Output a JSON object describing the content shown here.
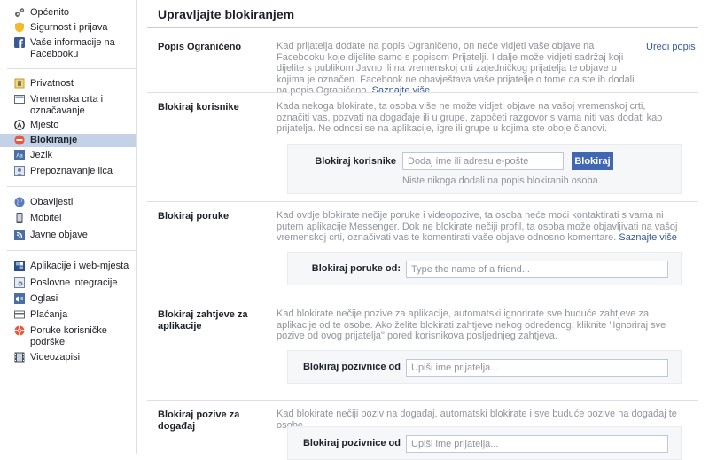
{
  "sidebar": {
    "items": [
      {
        "id": "general",
        "label": "Općenito"
      },
      {
        "id": "security",
        "label": "Sigurnost i prijava"
      },
      {
        "id": "your-info",
        "label": "Vaše informacije na Facebooku"
      },
      {
        "id": "privacy",
        "label": "Privatnost"
      },
      {
        "id": "timeline",
        "label": "Vremenska crta i označavanje"
      },
      {
        "id": "location",
        "label": "Mjesto"
      },
      {
        "id": "blocking",
        "label": "Blokiranje"
      },
      {
        "id": "language",
        "label": "Jezik"
      },
      {
        "id": "face-recognition",
        "label": "Prepoznavanje lica"
      },
      {
        "id": "notifications",
        "label": "Obavijesti"
      },
      {
        "id": "mobile",
        "label": "Mobitel"
      },
      {
        "id": "public-posts",
        "label": "Javne objave"
      },
      {
        "id": "apps",
        "label": "Aplikacije i web-mjesta"
      },
      {
        "id": "business",
        "label": "Poslovne integracije"
      },
      {
        "id": "ads",
        "label": "Oglasi"
      },
      {
        "id": "payments",
        "label": "Plaćanja"
      },
      {
        "id": "support-inbox",
        "label": "Poruke korisničke podrške"
      },
      {
        "id": "videos",
        "label": "Videozapisi"
      }
    ],
    "active": "Blokiranje",
    "accent_active": "#c4d2e7"
  },
  "main": {
    "title": "Upravljajte blokiranjem",
    "restricted": {
      "label": "Popis Ograničeno",
      "desc": "Kad prijatelja dodate na popis Ograničeno, on neće vidjeti vaše objave na Facebooku koje dijelite samo s popisom Prijatelji. I dalje može vidjeti sadržaj koji dijelite s publikom Javno ili na vremenskoj crti zajedničkog prijatelja te objave u kojima je označen. Facebook ne obavještava vaše prijatelje o tome da ste ih dodali na popis Ograničeno.",
      "learn_more": "Saznajte više",
      "edit_link": "Uredi popis"
    },
    "block_users": {
      "label": "Blokiraj korisnike",
      "desc": "Kada nekoga blokirate, ta osoba više ne može vidjeti objave na vašoj vremenskoj crti, označiti vas, pozvati na događaje ili u grupe, započeti razgovor s vama niti vas dodati kao prijatelja. Ne odnosi se na aplikacije, igre ili grupe u kojima ste oboje članovi.",
      "field_label": "Blokiraj korisnike",
      "placeholder": "Dodaj ime ili adresu e-pošte",
      "button": "Blokiraj",
      "note": "Niste nikoga dodali na popis blokiranih osoba."
    },
    "block_messages": {
      "label": "Blokiraj poruke",
      "desc": "Kad ovdje blokirate nečije poruke i videopozive, ta osoba neće moći kontaktirati s vama ni putem aplikacije Messenger. Dok ne blokirate nečiji profil, ta osoba može objavljivati na vašoj vremenskoj crti, označivati vas te komentirati vaše objave odnosno komentare.",
      "learn_more": "Saznajte više",
      "field_label": "Blokiraj poruke od:",
      "placeholder": "Type the name of a friend..."
    },
    "block_app_invites": {
      "label": "Blokiraj zahtjeve za aplikacije",
      "desc": "Kad blokirate nečije pozive za aplikacije, automatski ignorirate sve buduće zahtjeve za aplikacije od te osobe. Ako želite blokirati zahtjeve nekog određenog, kliknite \"Ignoriraj sve pozive od ovog prijatelja\" pored korisnikova posljednjeg zahtjeva.",
      "field_label": "Blokiraj pozivnice od",
      "placeholder": "Upiši ime prijatelja..."
    },
    "block_event_invites": {
      "label": "Blokiraj pozive za događaj",
      "desc": "Kad blokirate nečiji poziv na događaj, automatski blokirate i sve buduće pozive na događaj te osobe.",
      "field_label": "Blokiraj pozivnice od",
      "placeholder": "Upiši ime prijatelja..."
    }
  },
  "colors": {
    "link": "#365899",
    "button": "#4267b2",
    "muted": "#90949c"
  }
}
